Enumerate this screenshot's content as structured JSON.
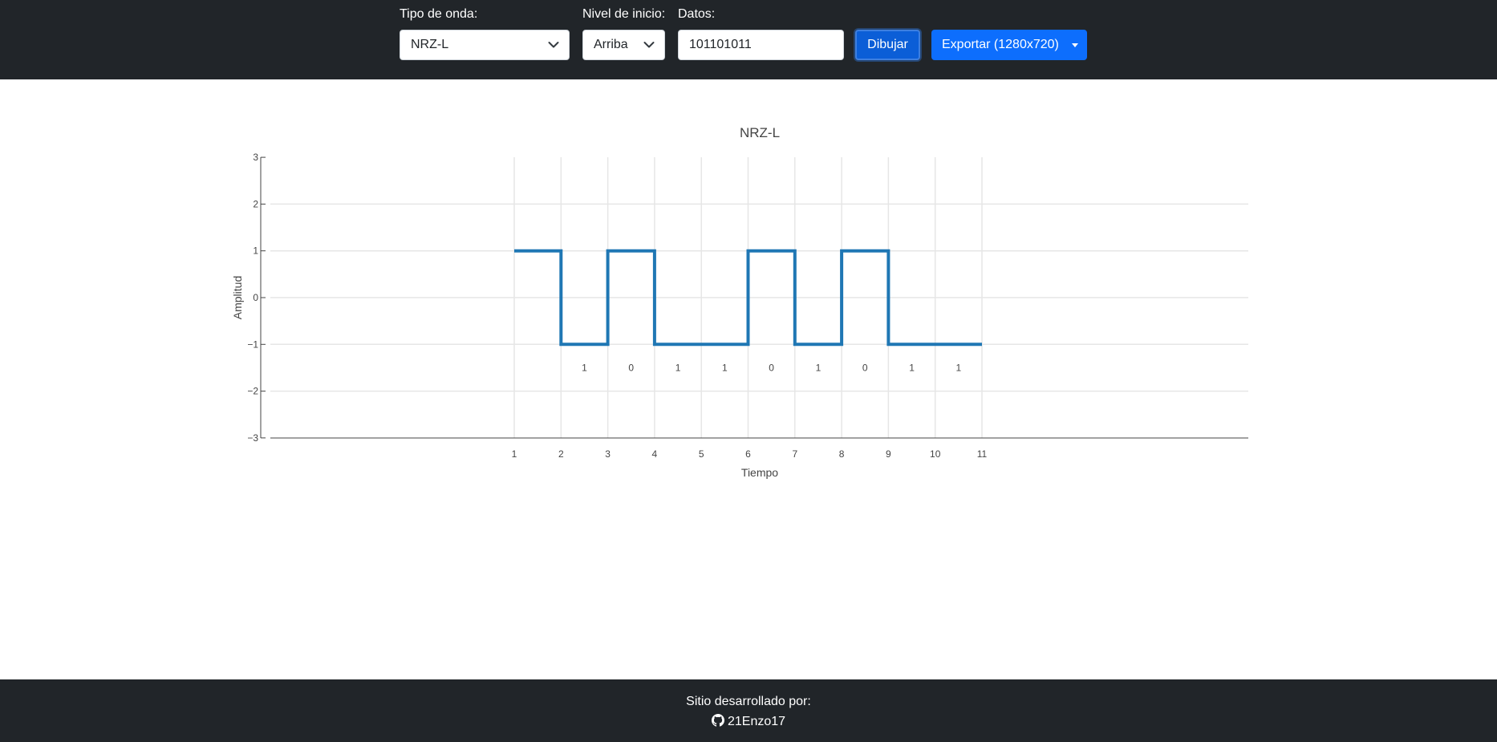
{
  "controls": {
    "wave_type_label": "Tipo de onda:",
    "wave_type_value": "NRZ-L",
    "start_level_label": "Nivel de inicio:",
    "start_level_value": "Arriba",
    "data_label": "Datos:",
    "data_value": "101101011",
    "draw_button": "Dibujar",
    "export_button": "Exportar (1280x720)"
  },
  "icons": {
    "wave_type_chevron": "chevron-down-icon",
    "start_level_chevron": "chevron-down-icon",
    "export_dropdown": "caret-down-icon",
    "footer_github": "github-icon"
  },
  "colors": {
    "topbar": "#212529",
    "primary": "#0d6efd",
    "signal": "#1f77b4",
    "grid": "#e6e6e6"
  },
  "chart_data": {
    "type": "line",
    "title": "NRZ-L",
    "xlabel": "Tiempo",
    "ylabel": "Amplitud",
    "step": true,
    "x": [
      1,
      2,
      2,
      3,
      3,
      4,
      4,
      5,
      6,
      6,
      7,
      7,
      8,
      8,
      9,
      9,
      10,
      11
    ],
    "y": [
      1,
      1,
      -1,
      -1,
      1,
      1,
      -1,
      -1,
      -1,
      1,
      1,
      -1,
      -1,
      1,
      1,
      -1,
      -1,
      -1
    ],
    "x_ticks": [
      1,
      2,
      3,
      4,
      5,
      6,
      7,
      8,
      9,
      10,
      11
    ],
    "y_ticks": [
      3,
      2,
      1,
      0,
      -1,
      -2,
      -3
    ],
    "y_tick_labels": [
      "3",
      "2",
      "1",
      "0",
      "−1",
      "−2",
      "−3"
    ],
    "ylim": [
      -3,
      3
    ],
    "grid": true,
    "bit_labels": [
      {
        "x": 2.5,
        "label": "1"
      },
      {
        "x": 3.5,
        "label": "0"
      },
      {
        "x": 4.5,
        "label": "1"
      },
      {
        "x": 5.5,
        "label": "1"
      },
      {
        "x": 6.5,
        "label": "0"
      },
      {
        "x": 7.5,
        "label": "1"
      },
      {
        "x": 8.5,
        "label": "0"
      },
      {
        "x": 9.5,
        "label": "1"
      },
      {
        "x": 10.5,
        "label": "1"
      }
    ],
    "bit_label_y": -1.5
  },
  "footer": {
    "credit": "Sitio desarrollado por:",
    "author": "21Enzo17"
  }
}
